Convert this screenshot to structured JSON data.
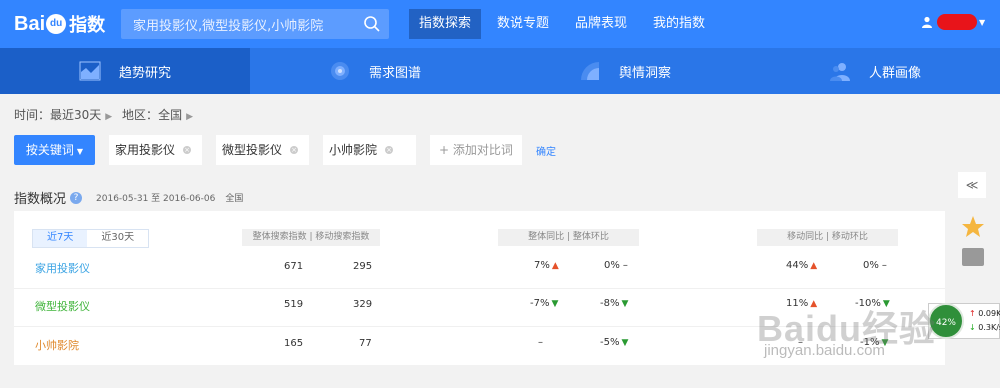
{
  "header": {
    "logo_text": "Bai",
    "logo_du": "du",
    "logo_suffix": "指数",
    "search_value": "家用投影仪,微型投影仪,小帅影院",
    "nav": [
      "指数探索",
      "数说专题",
      "品牌表现",
      "我的指数"
    ]
  },
  "subnav": [
    "趋势研究",
    "需求图谱",
    "舆情洞察",
    "人群画像"
  ],
  "breadcrumb": {
    "time_label": "时间：",
    "time_value": "最近30天",
    "region_label": "地区：",
    "region_value": "全国"
  },
  "keywords": {
    "button_label": "按关键词",
    "items": [
      "家用投影仪",
      "微型投影仪",
      "小帅影院"
    ],
    "add_label": "添加对比词",
    "confirm_label": "确定"
  },
  "overview": {
    "title": "指数概况",
    "date_range": "2016-05-31 至 2016-06-06",
    "region": "全国",
    "period_tabs": [
      "近7天",
      "近30天"
    ],
    "col_group_1": "整体搜索指数 | 移动搜索指数",
    "col_group_2": "整体同比 | 整体环比",
    "col_group_3": "移动同比 | 移动环比",
    "rows": [
      {
        "name": "家用投影仪",
        "color": "#3aa3e3",
        "total": "671",
        "mobile": "295",
        "total_yoy": "7%",
        "total_yoy_dir": "up",
        "total_mom": "0%",
        "total_mom_dir": "flat",
        "mobile_yoy": "44%",
        "mobile_yoy_dir": "up",
        "mobile_mom": "0%",
        "mobile_mom_dir": "flat"
      },
      {
        "name": "微型投影仪",
        "color": "#3fb43a",
        "total": "519",
        "mobile": "329",
        "total_yoy": "-7%",
        "total_yoy_dir": "down",
        "total_mom": "-8%",
        "total_mom_dir": "down",
        "mobile_yoy": "11%",
        "mobile_yoy_dir": "up",
        "mobile_mom": "-10%",
        "mobile_mom_dir": "down"
      },
      {
        "name": "小帅影院",
        "color": "#e08a2e",
        "total": "165",
        "mobile": "77",
        "total_yoy": "–",
        "total_yoy_dir": "none",
        "total_mom": "-5%",
        "total_mom_dir": "down",
        "mobile_yoy": "–",
        "mobile_yoy_dir": "none",
        "mobile_mom": "-1%",
        "mobile_mom_dir": "down"
      }
    ]
  },
  "net_widget": {
    "percent": "42%",
    "up": "0.09K/s",
    "down": "0.3K/s"
  },
  "watermark": {
    "text": "Baidu经验",
    "url": "jingyan.baidu.com"
  }
}
